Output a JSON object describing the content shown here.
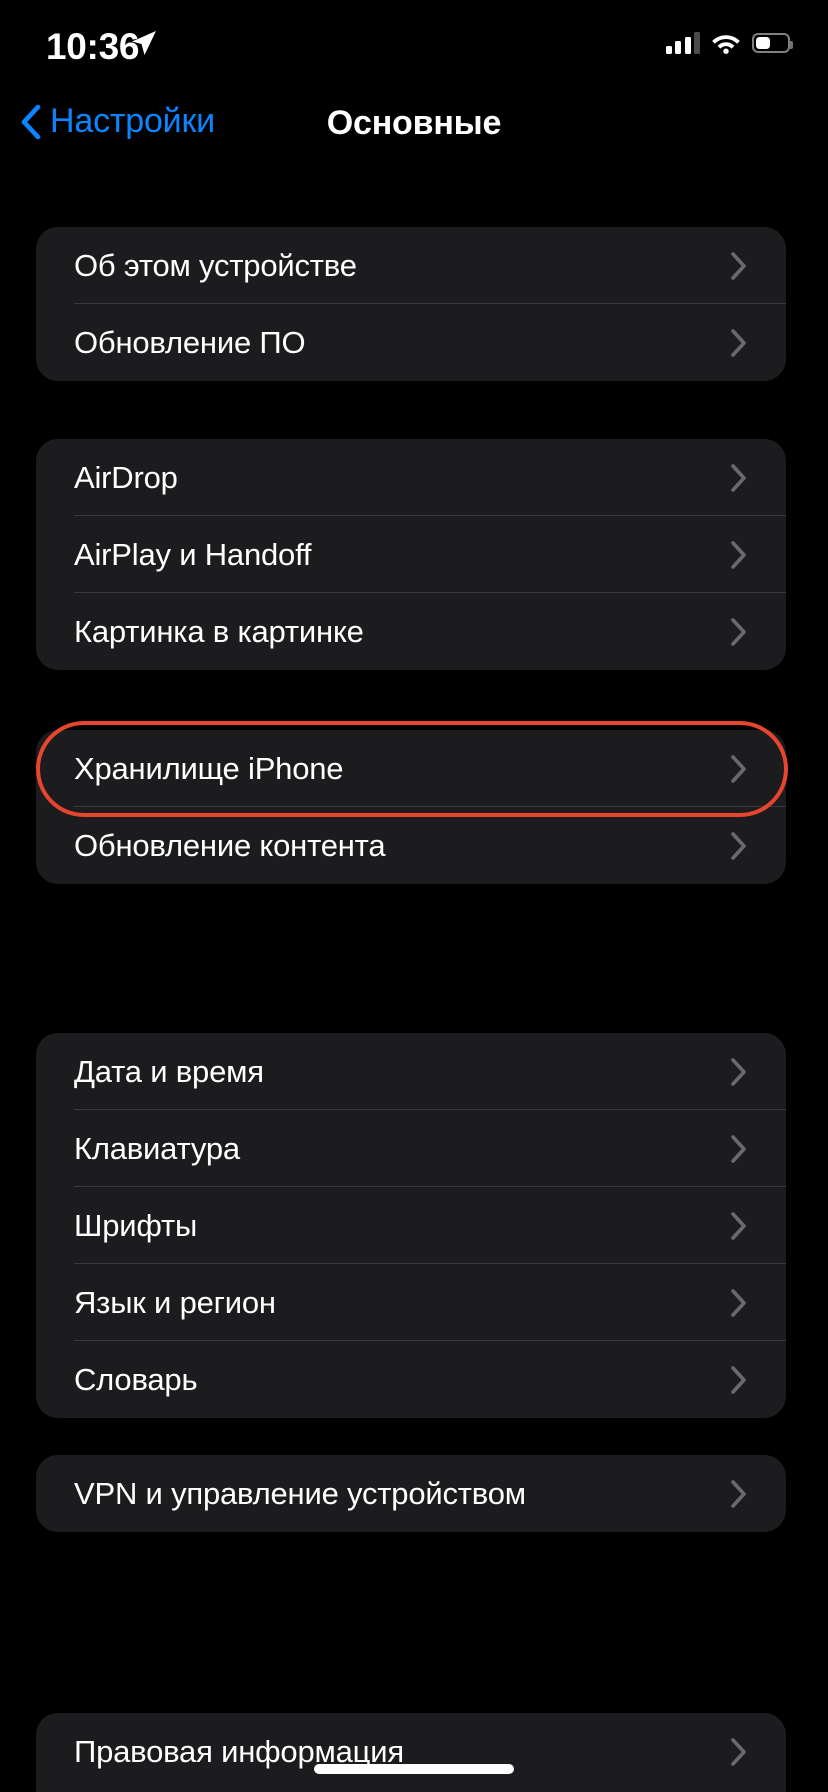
{
  "status_bar": {
    "time": "10:36",
    "location_icon": "location-arrow-icon",
    "cellular_icon": "cellular-signal-icon",
    "cellular_bars_active": 3,
    "cellular_bars_total": 4,
    "wifi_icon": "wifi-icon",
    "battery_icon": "battery-icon",
    "battery_level_percent": 45
  },
  "nav": {
    "back_icon": "chevron-left-icon",
    "back_label": "Настройки",
    "title": "Основные"
  },
  "colors": {
    "page_background": "#000000",
    "card_background": "#1c1c1e",
    "separator": "#3a3a3c",
    "accent_blue": "#0a84ff",
    "highlight_red": "#e8452e",
    "label_primary": "#ffffff",
    "chevron_gray": "#6a6a6e"
  },
  "chevron_icon": "chevron-right-icon",
  "groups": [
    {
      "name": "device-info-group",
      "rows": [
        {
          "label": "Об этом устройстве"
        },
        {
          "label": "Обновление ПО"
        }
      ]
    },
    {
      "name": "sharing-group",
      "rows": [
        {
          "label": "AirDrop"
        },
        {
          "label": "AirPlay и Handoff"
        },
        {
          "label": "Картинка в картинке"
        }
      ]
    },
    {
      "name": "storage-group",
      "rows": [
        {
          "label": "Хранилище iPhone",
          "highlighted": true
        },
        {
          "label": "Обновление контента"
        }
      ]
    },
    {
      "name": "locale-group",
      "rows": [
        {
          "label": "Дата и время"
        },
        {
          "label": "Клавиатура"
        },
        {
          "label": "Шрифты"
        },
        {
          "label": "Язык и регион"
        },
        {
          "label": "Словарь"
        }
      ]
    },
    {
      "name": "vpn-group",
      "rows": [
        {
          "label": "VPN и управление устройством"
        }
      ]
    },
    {
      "name": "legal-group",
      "rows": [
        {
          "label": "Правовая информация"
        }
      ]
    }
  ]
}
